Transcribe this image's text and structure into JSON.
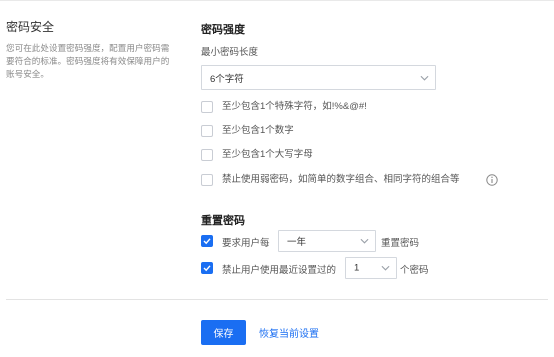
{
  "left": {
    "title": "密码安全",
    "description": "您可在此处设置密码强度，配置用户密码需要符合的标准。密码强度将有效保障用户的账号安全。"
  },
  "strength": {
    "title": "密码强度",
    "min_length_label": "最小密码长度",
    "min_length_value": "6个字符",
    "rules": [
      {
        "label": "至少包含1个特殊字符，如!%&@#!",
        "checked": false
      },
      {
        "label": "至少包含1个数字",
        "checked": false
      },
      {
        "label": "至少包含1个大写字母",
        "checked": false
      },
      {
        "label": "禁止使用弱密码，如简单的数字组合、相同字符的组合等",
        "checked": false
      }
    ]
  },
  "reset": {
    "title": "重置密码",
    "row1": {
      "prefix": "要求用户每",
      "period_value": "一年",
      "suffix": "重置密码",
      "checked": true
    },
    "row2": {
      "prefix": "禁止用户使用最近设置过的",
      "count_value": "1",
      "suffix": "个密码",
      "checked": true
    }
  },
  "actions": {
    "save_label": "保存",
    "restore_label": "恢复当前设置"
  },
  "colors": {
    "accent": "#1a6ef2",
    "border": "#d4d8de",
    "muted": "#8a8a8a"
  }
}
